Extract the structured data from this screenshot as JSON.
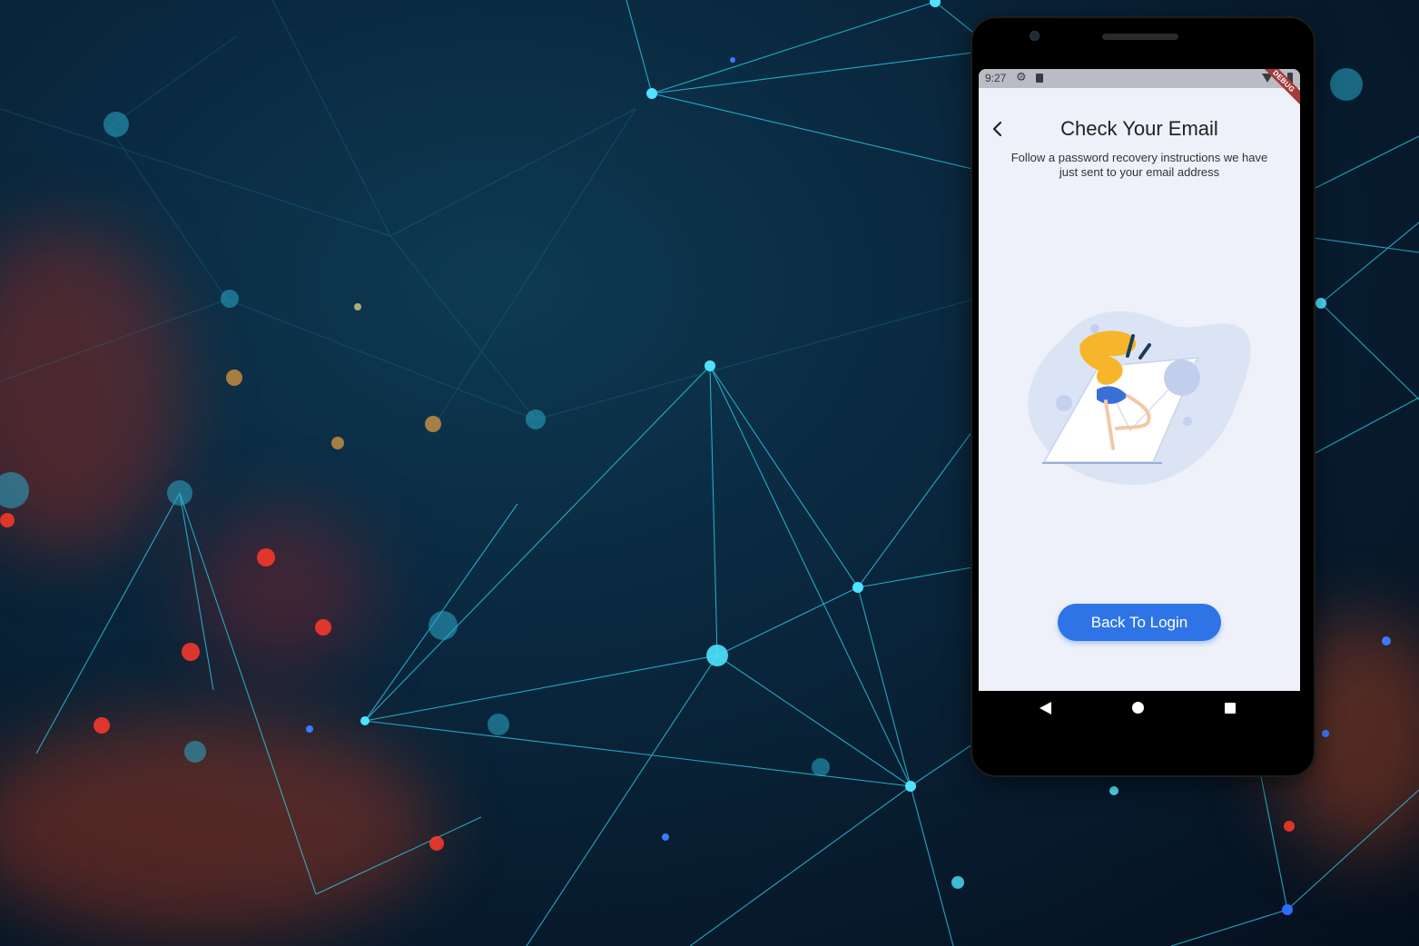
{
  "status_bar": {
    "time": "9:27",
    "debug_banner": "DEBUG"
  },
  "screen": {
    "title": "Check Your Email",
    "subtitle": "Follow a password recovery instructions we have just sent to your email address",
    "primary_button_label": "Back To Login"
  },
  "icons": {
    "back": "chevron-left-icon",
    "settings": "gear-icon",
    "sd_card": "sd-card-icon",
    "wifi": "wifi-icon",
    "battery": "battery-icon",
    "nav_back": "triangle-back-icon",
    "nav_home": "circle-home-icon",
    "nav_recents": "square-recents-icon"
  },
  "colors": {
    "accent": "#2f74e6",
    "screen_background": "#eef1f9",
    "status_bar": "#b9bcc4",
    "debug_ribbon": "#a53a3a"
  }
}
